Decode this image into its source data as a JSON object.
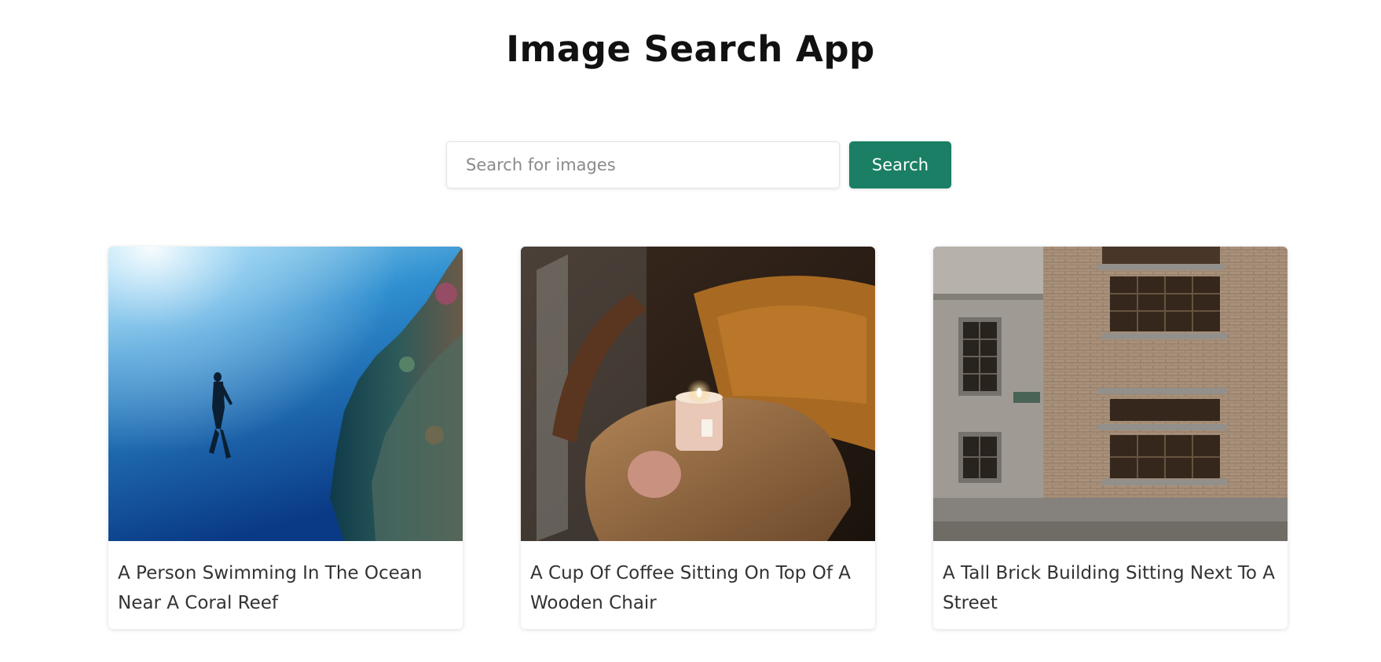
{
  "app": {
    "title": "Image Search App"
  },
  "search": {
    "placeholder": "Search for images",
    "value": "",
    "button_label": "Search",
    "accent_color": "#1a7f64"
  },
  "results": [
    {
      "image": "person-swimming-near-coral-reef-photo",
      "caption": "A Person Swimming In The Ocean Near A Coral Reef"
    },
    {
      "image": "candle-on-wooden-chair-photo",
      "caption": "A Cup Of Coffee Sitting On Top Of A Wooden Chair"
    },
    {
      "image": "brick-building-facade-photo",
      "caption": "A Tall Brick Building Sitting Next To A Street"
    }
  ]
}
